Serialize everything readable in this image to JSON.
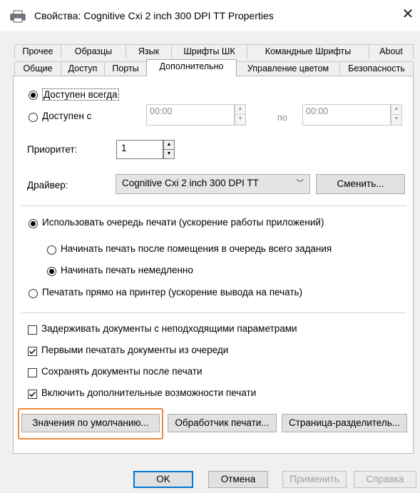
{
  "window": {
    "title": "Свойства: Cognitive Cxi 2 inch 300 DPI TT Properties",
    "close_glyph": "✕"
  },
  "tabs_row1": [
    "Прочее",
    "Образцы",
    "Язык",
    "Шрифты ШК",
    "Командные Шрифты",
    "About"
  ],
  "tabs_row2": [
    "Общие",
    "Доступ",
    "Порты",
    "Дополнительно",
    "Управление цветом",
    "Безопасность"
  ],
  "active_tab": "Дополнительно",
  "availability": {
    "always_label": "Доступен всегда",
    "always_selected": true,
    "from_label": "Доступен с",
    "from_time": "00:00",
    "to_label": "по",
    "to_time": "00:00"
  },
  "priority": {
    "label": "Приоритет:",
    "value": "1"
  },
  "driver": {
    "label": "Драйвер:",
    "selected": "Cognitive Cxi 2 inch 300 DPI TT",
    "change_button": "Сменить..."
  },
  "spool": {
    "use_queue_label": "Использовать очередь печати (ускорение работы приложений)",
    "use_queue_selected": true,
    "start_after_label": "Начинать печать после помещения в очередь всего задания",
    "start_after_selected": false,
    "start_now_label": "Начинать печать немедленно",
    "start_now_selected": true,
    "direct_label": "Печатать прямо на принтер (ускорение вывода на печать)",
    "direct_selected": false
  },
  "options": [
    {
      "label": "Задерживать документы с неподходящими параметрами",
      "checked": false
    },
    {
      "label": "Первыми печатать документы из очереди",
      "checked": true
    },
    {
      "label": "Сохранять документы после печати",
      "checked": false
    },
    {
      "label": "Включить дополнительные возможности печати",
      "checked": true
    }
  ],
  "buttons": {
    "defaults": "Значения по умолчанию...",
    "processor": "Обработчик печати...",
    "separator": "Страница-разделитель..."
  },
  "footer": {
    "ok": "OK",
    "cancel": "Отмена",
    "apply": "Применить",
    "help": "Справка"
  },
  "colors": {
    "highlight": "#f0883e",
    "focus": "#0078d7"
  }
}
